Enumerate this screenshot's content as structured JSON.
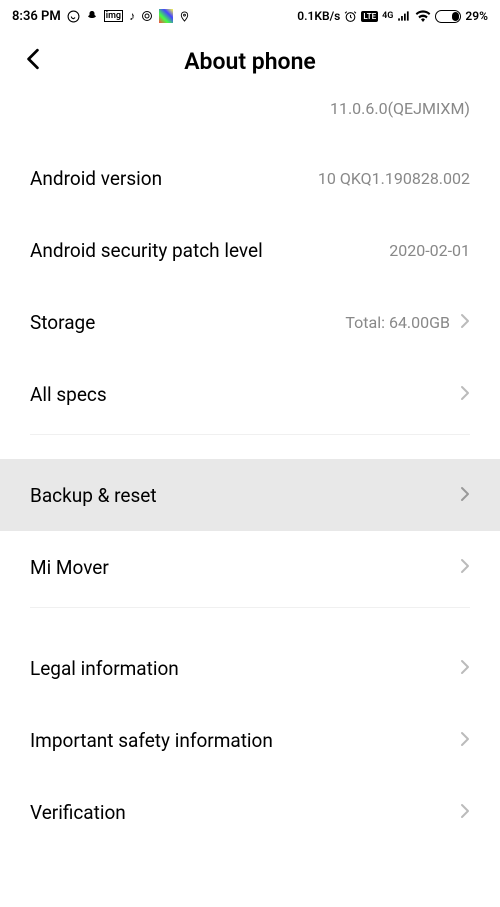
{
  "statusBar": {
    "time": "8:36 PM",
    "dataSpeed": "0.1KB/s",
    "battery": "29%"
  },
  "header": {
    "title": "About phone"
  },
  "versionSubtitle": "11.0.6.0(QEJMIXM)",
  "items": {
    "androidVersion": {
      "label": "Android version",
      "value": "10 QKQ1.190828.002"
    },
    "securityPatch": {
      "label": "Android security patch level",
      "value": "2020-02-01"
    },
    "storage": {
      "label": "Storage",
      "value": "Total: 64.00GB"
    },
    "allSpecs": {
      "label": "All specs"
    },
    "backupReset": {
      "label": "Backup & reset"
    },
    "miMover": {
      "label": "Mi Mover"
    },
    "legal": {
      "label": "Legal information"
    },
    "safety": {
      "label": "Important safety information"
    },
    "verification": {
      "label": "Verification"
    }
  }
}
